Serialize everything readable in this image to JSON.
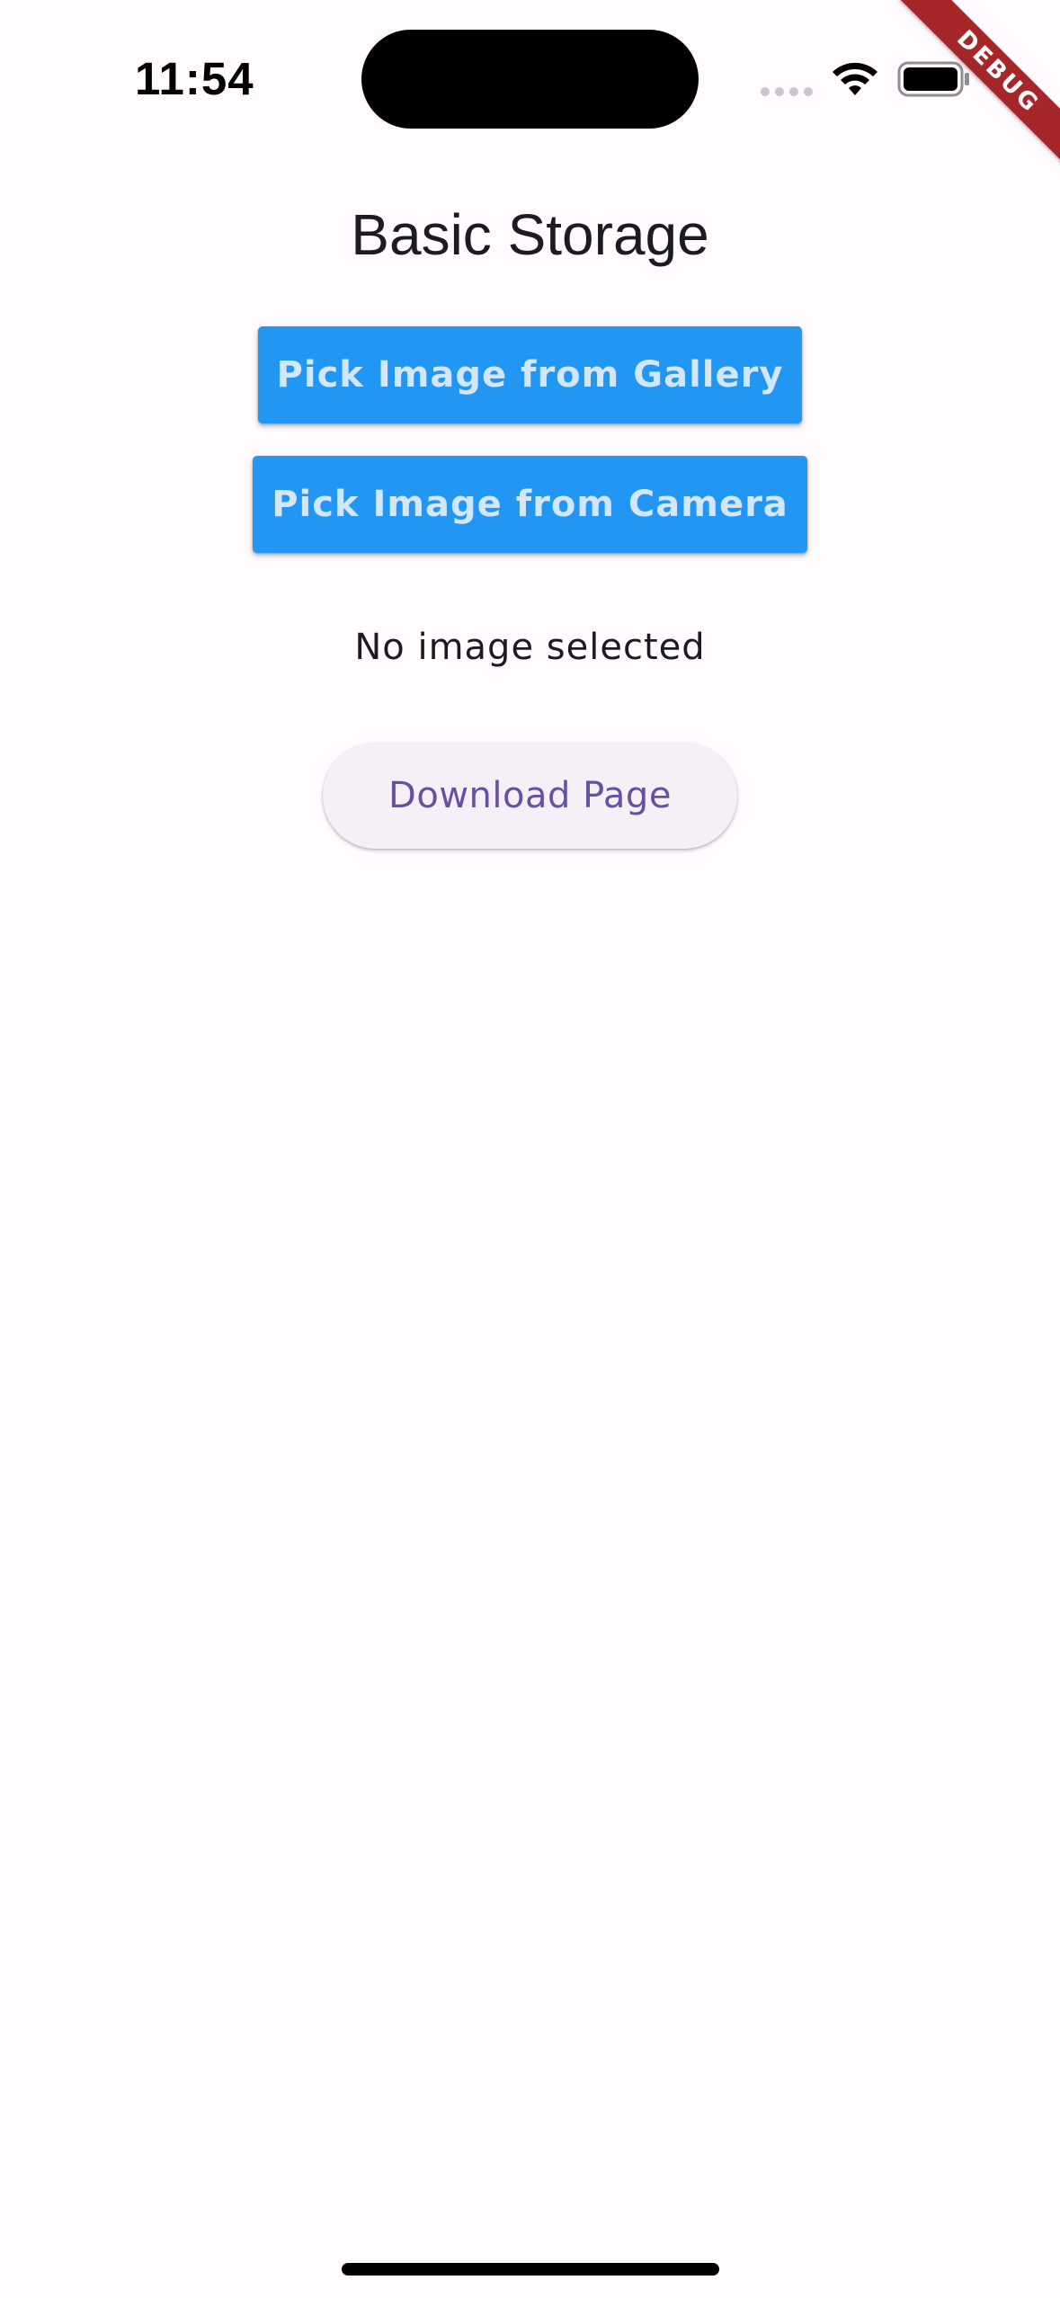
{
  "status_bar": {
    "time": "11:54"
  },
  "debug_banner": {
    "label": "DEBUG",
    "color": "#a6272a"
  },
  "page": {
    "title": "Basic Storage",
    "background": "#fffbfe"
  },
  "buttons": {
    "gallery_label": "Pick Image from Gallery",
    "camera_label": "Pick Image from Camera",
    "download_label": "Download Page",
    "primary_color": "#2196f3",
    "download_text_color": "#6750a4"
  },
  "image_status": {
    "text": "No image selected"
  },
  "icons": {
    "signal": "cellular-signal-icon",
    "wifi": "wifi-icon",
    "battery": "battery-icon"
  }
}
